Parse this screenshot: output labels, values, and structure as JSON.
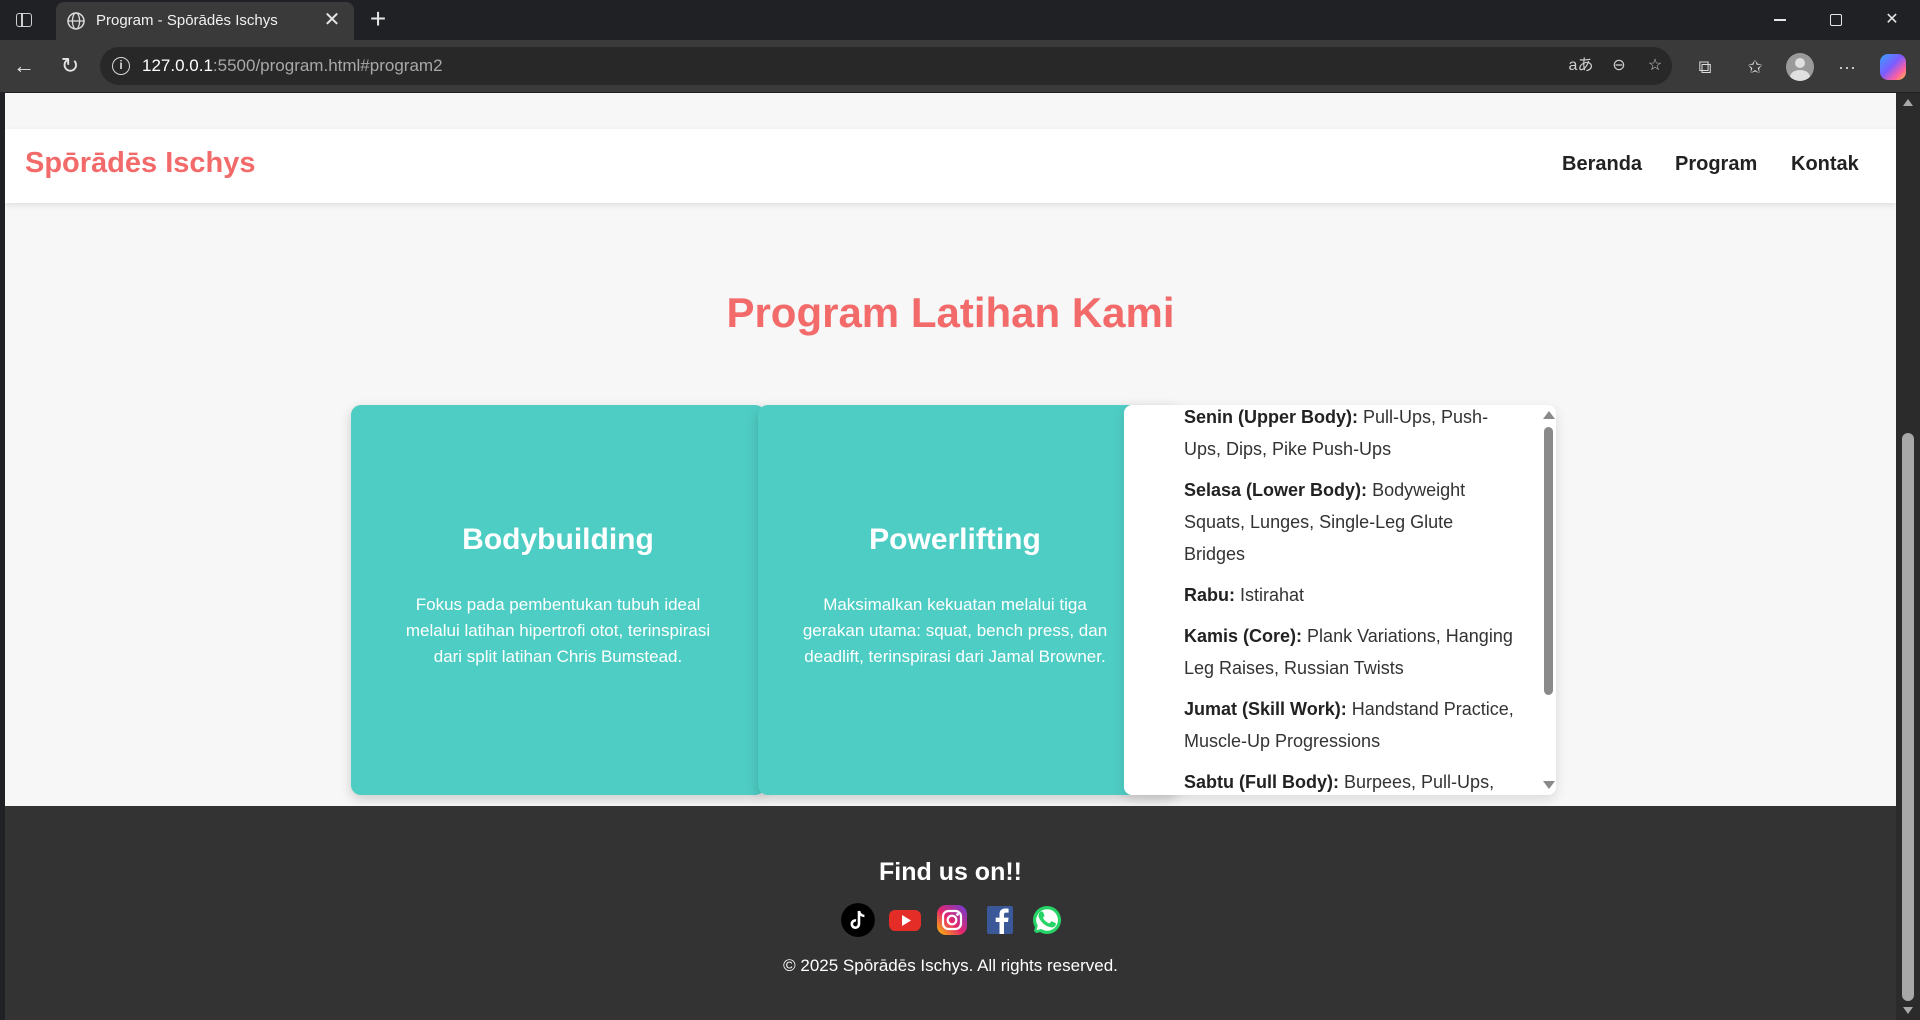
{
  "browser": {
    "tab_title": "Program - Spōrādēs Ischys",
    "url_host": "127.0.0.1",
    "url_rest": ":5500/program.html#program2",
    "icons": [
      "tab-actions-icon",
      "globe-icon",
      "close-icon",
      "plus-icon",
      "minimize-icon",
      "maximize-icon",
      "back-icon",
      "reload-icon",
      "info-icon",
      "read-aloud-icon",
      "zoom-icon",
      "star-icon",
      "extensions-icon",
      "favorites-icon",
      "profile-icon",
      "more-icon",
      "copilot-icon"
    ]
  },
  "nav": {
    "brand": "Spōrādēs Ischys",
    "links": [
      "Beranda",
      "Program",
      "Kontak"
    ]
  },
  "colors": {
    "accent": "#f26a6a",
    "card": "#4ecdc4",
    "footer": "#333333"
  },
  "section": {
    "title": "Program Latihan Kami"
  },
  "cards": [
    {
      "title": "Bodybuilding",
      "desc": "Fokus pada pembentukan tubuh ideal melalui latihan hipertrofi otot, terinspirasi dari split latihan Chris Bumstead."
    },
    {
      "title": "Powerlifting",
      "desc": "Maksimalkan kekuatan melalui tiga gerakan utama: squat, bench press, dan deadlift, terinspirasi dari Jamal Browner."
    }
  ],
  "schedule": [
    {
      "day": "Senin (Upper Body):",
      "text": "Pull-Ups, Push-Ups, Dips, Pike Push-Ups"
    },
    {
      "day": "Selasa (Lower Body):",
      "text": "Bodyweight Squats, Lunges, Single-Leg Glute Bridges"
    },
    {
      "day": "Rabu:",
      "text": "Istirahat"
    },
    {
      "day": "Kamis (Core):",
      "text": "Plank Variations, Hanging Leg Raises, Russian Twists"
    },
    {
      "day": "Jumat (Skill Work):",
      "text": "Handstand Practice, Muscle-Up Progressions"
    },
    {
      "day": "Sabtu (Full Body):",
      "text": "Burpees, Pull-Ups,"
    }
  ],
  "footer": {
    "title": "Find us on!!",
    "socials": [
      "tiktok-icon",
      "youtube-icon",
      "instagram-icon",
      "facebook-icon",
      "whatsapp-icon"
    ],
    "copyright": "© 2025 Spōrādēs Ischys. All rights reserved."
  }
}
